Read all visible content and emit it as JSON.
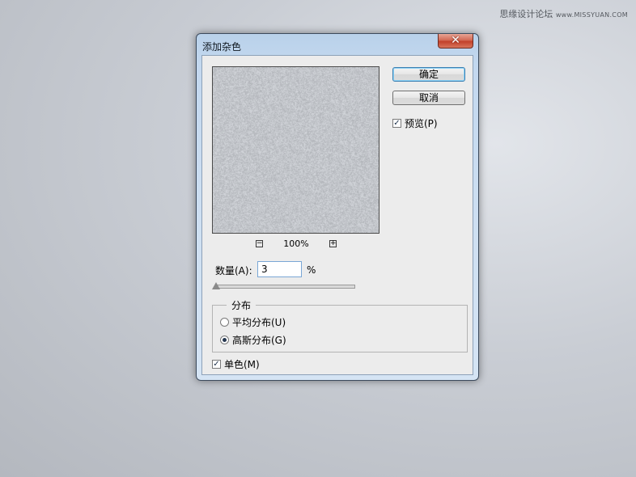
{
  "watermark": {
    "site_name": "思缘设计论坛",
    "url": "www.MISSYUAN.COM"
  },
  "dialog": {
    "title": "添加杂色",
    "close_glyph": "✕",
    "buttons": {
      "ok": "确定",
      "cancel": "取消"
    },
    "preview": {
      "checkbox_label": "预览(P)",
      "checked": true
    },
    "zoom": {
      "level": "100%",
      "zoom_out_glyph": "−",
      "zoom_in_glyph": "+"
    },
    "amount": {
      "label": "数量(A):",
      "value": "3",
      "unit": "%",
      "slider_fraction": 0.0075
    },
    "distribution": {
      "group_title": "分布",
      "options": [
        {
          "label": "平均分布(U)",
          "selected": false
        },
        {
          "label": "高斯分布(G)",
          "selected": true
        }
      ]
    },
    "monochromatic": {
      "label": "单色(M)",
      "checked": true
    },
    "check_glyph": "✓"
  }
}
